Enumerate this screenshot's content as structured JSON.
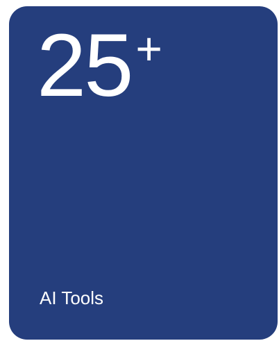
{
  "card": {
    "value": "25",
    "suffix": "+",
    "label": "AI Tools",
    "background_color": "#253e7d",
    "text_color": "#ffffff"
  }
}
